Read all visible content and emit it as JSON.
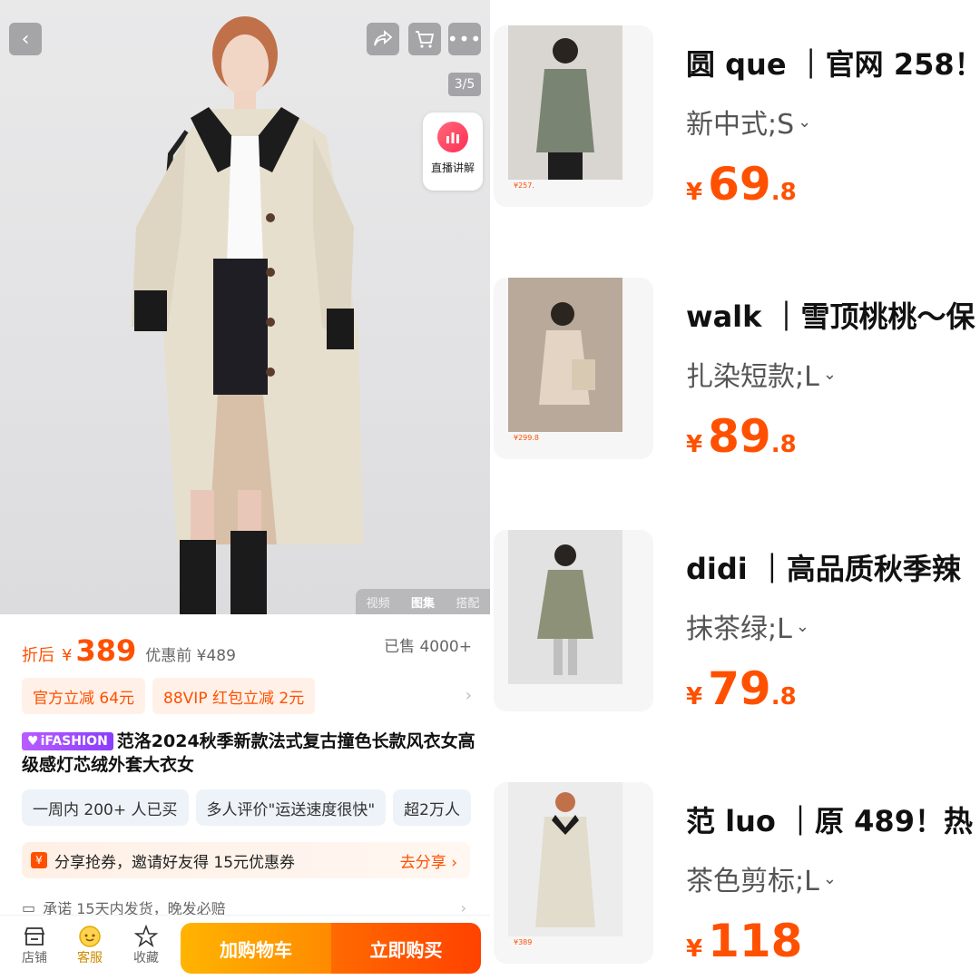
{
  "product": {
    "page_indicator": "3/5",
    "live_label": "直播讲解",
    "media_tabs": [
      "视频",
      "图集",
      "搭配"
    ],
    "price_prefix": "折后",
    "currency": "¥",
    "price": "389",
    "original_label": "优惠前 ¥489",
    "sold": "已售 4000+",
    "coupons": [
      "官方立减 64元",
      "88VIP 红包立减 2元"
    ],
    "brand_badge": "iFASHION",
    "title": "范洛2024秋季新款法式复古撞色长款风衣女高级感灯芯绒外套大衣女",
    "social_proof": [
      "一周内 200+ 人已买",
      "多人评价\"运送速度很快\"",
      "超2万人"
    ],
    "share_text": "分享抢券，邀请好友得 15元优惠券",
    "share_button": "去分享",
    "promise": "承诺 15天内发货，晚发必赔"
  },
  "bottom_bar": {
    "items": [
      {
        "label": "店铺",
        "icon": "store-icon"
      },
      {
        "label": "客服",
        "icon": "customer-service-icon"
      },
      {
        "label": "收藏",
        "icon": "star-icon"
      }
    ],
    "add_to_cart": "加购物车",
    "buy_now": "立即购买"
  },
  "recommendations": [
    {
      "title": "圆 que ｜官网 258！",
      "variant": "新中式;S",
      "currency": "¥",
      "price_int": "69",
      "price_dec": ".8",
      "thumb_price": "¥257.",
      "thumb_color": "#7a8472"
    },
    {
      "title": "walk ｜雪顶桃桃～保",
      "variant": "扎染短款;L",
      "currency": "¥",
      "price_int": "89",
      "price_dec": ".8",
      "thumb_price": "¥299.8",
      "thumb_color": "#c8b8a8"
    },
    {
      "title": "didi ｜高品质秋季辣",
      "variant": "抹茶绿;L",
      "currency": "¥",
      "price_int": "79",
      "price_dec": ".8",
      "thumb_price": "",
      "thumb_color": "#8c9178"
    },
    {
      "title": "范 luo ｜原 489！热",
      "variant": "茶色剪标;L",
      "currency": "¥",
      "price_int": "118",
      "price_dec": "",
      "thumb_price": "¥389",
      "thumb_color": "#e2dccd"
    }
  ],
  "colors": {
    "accent": "#ff5000",
    "cart": "#ffa000",
    "buy": "#ff5000"
  }
}
